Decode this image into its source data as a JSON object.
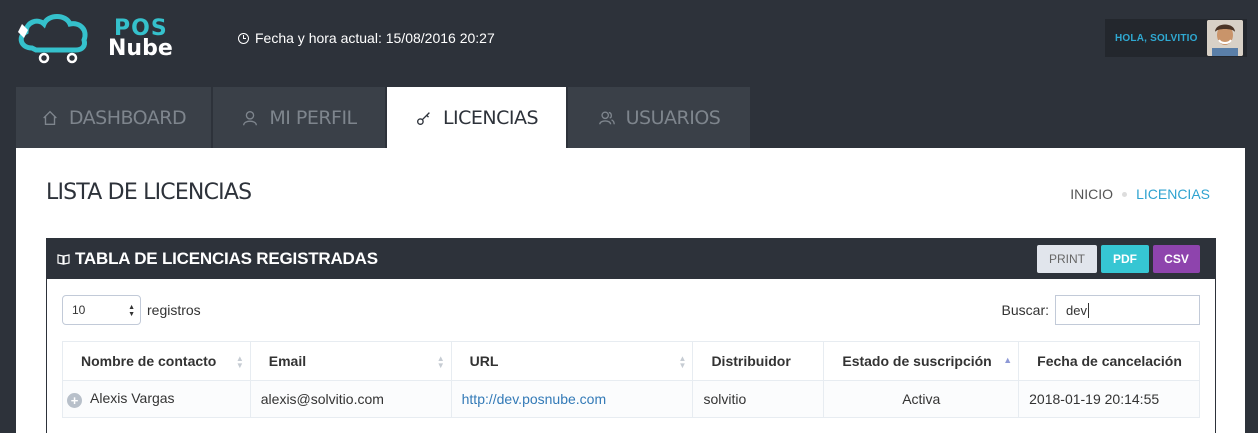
{
  "app": {
    "logo_line1": "POS",
    "logo_line2": "Nube",
    "datetime_label": "Fecha y hora actual: 15/08/2016 20:27",
    "user_greeting": "HOLA, SOLVITIO"
  },
  "tabs": [
    {
      "label": "DASHBOARD",
      "icon": "home-icon"
    },
    {
      "label": "MI PERFIL",
      "icon": "user-icon"
    },
    {
      "label": "LICENCIAS",
      "icon": "key-icon",
      "active": true
    },
    {
      "label": "USUARIOS",
      "icon": "users-icon"
    }
  ],
  "page": {
    "title": "LISTA DE LICENCIAS",
    "breadcrumb": [
      "INICIO",
      "LICENCIAS"
    ]
  },
  "portlet": {
    "title": "TABLA DE LICENCIAS REGISTRADAS",
    "buttons": {
      "print": "PRINT",
      "pdf": "PDF",
      "csv": "CSV"
    }
  },
  "controls": {
    "page_length_value": "10",
    "page_length_suffix": "registros",
    "search_label": "Buscar:",
    "search_value": "dev"
  },
  "table": {
    "columns": [
      "Nombre de contacto",
      "Email",
      "URL",
      "Distribuidor",
      "Estado de suscripción",
      "Fecha de cancelación"
    ],
    "rows": [
      [
        "Alexis Vargas",
        "alexis@solvitio.com",
        "http://dev.posnube.com",
        "solvitio",
        "Activa",
        "2018-01-19 20:14:55"
      ]
    ]
  },
  "colors": {
    "header_bg": "#2d323a",
    "accent_cyan": "#36c6d3",
    "accent_purple": "#8e44ad",
    "link_blue": "#2fa3d0"
  }
}
